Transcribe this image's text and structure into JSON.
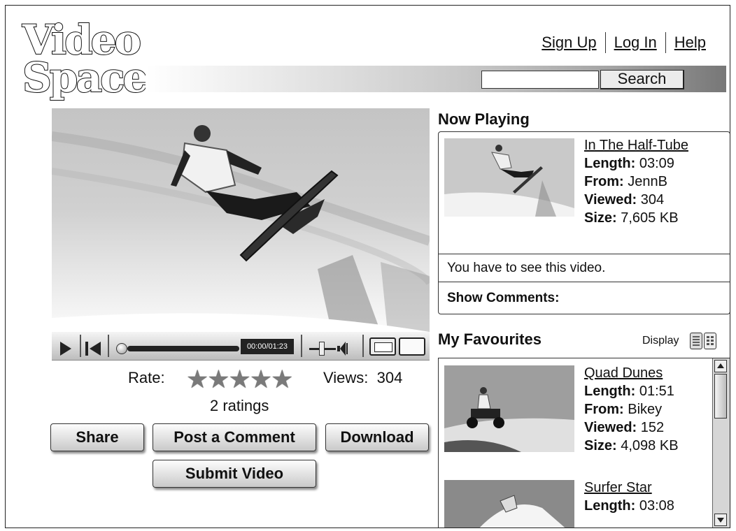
{
  "logo": {
    "line1": "Video",
    "line2": "Space"
  },
  "nav": {
    "signup": "Sign Up",
    "login": "Log In",
    "help": "Help"
  },
  "search": {
    "button": "Search",
    "value": ""
  },
  "player": {
    "time": "00:00/01:23",
    "progress": 0.0
  },
  "rating": {
    "label": "Rate:",
    "stars": "★★★★★",
    "count_text": "2 ratings"
  },
  "views": {
    "label": "Views:",
    "value": "304"
  },
  "actions": {
    "share": "Share",
    "comment": "Post a Comment",
    "download": "Download",
    "submit": "Submit Video"
  },
  "now_playing": {
    "heading": "Now Playing",
    "title": "In The Half-Tube",
    "length_label": "Length:",
    "length": "03:09",
    "from_label": "From:",
    "from": "JennB",
    "viewed_label": "Viewed:",
    "viewed": "304",
    "size_label": "Size:",
    "size": "7,605 KB",
    "description": "You have to see this video.",
    "comments_label": "Show Comments:"
  },
  "favourites": {
    "heading": "My Favourites",
    "display_label": "Display",
    "items": [
      {
        "title": "Quad Dunes",
        "length": "01:51",
        "from": "Bikey",
        "viewed": "152",
        "size": "4,098 KB"
      },
      {
        "title": "Surfer Star",
        "length": "03:08"
      }
    ],
    "labels": {
      "length": "Length:",
      "from": "From:",
      "viewed": "Viewed:",
      "size": "Size:"
    }
  }
}
